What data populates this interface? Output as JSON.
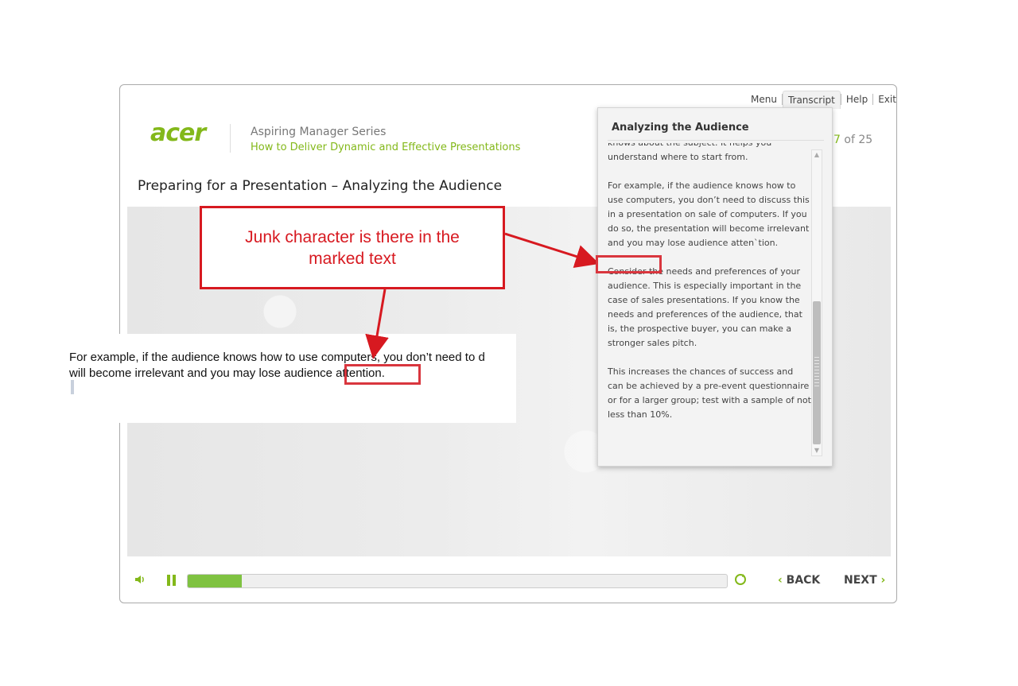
{
  "nav": {
    "menu": "Menu",
    "transcript": "Transcript",
    "help": "Help",
    "exit": "Exit"
  },
  "header": {
    "logo": "acer",
    "series": "Aspiring Manager Series",
    "course": "How to Deliver Dynamic and Effective Presentations"
  },
  "page_counter": {
    "current": "7",
    "of_total": " of 25"
  },
  "slide": {
    "title": "Preparing for a Presentation – Analyzing the Audience",
    "text_line1": "For example,  if the audience  knows  how to  use computers,  you  don’t need  to d",
    "text_line2": "will become  irrelevant and you may  lose audience  attention."
  },
  "annotation": {
    "callout": "Junk character is there in the marked text"
  },
  "transcript": {
    "title": "Analyzing the Audience",
    "paragraphs": [
      "knows about the subject. It helps you understand where to start from.",
      "For example, if the audience knows how to use computers, you don’t need to discuss this in a presentation on sale of computers. If you do so, the presentation will become irrelevant and you may lose audience atten`tion.",
      "Consider the needs and preferences of your audience. This is especially important in the case of sales presentations. If you know the needs and preferences of the audience, that is, the prospective buyer, you can make a stronger sales pitch.",
      "This increases the chances of success and can be achieved by a pre-event questionnaire or for a larger group; test with a sample of not less than 10%."
    ]
  },
  "player": {
    "progress": 0.1,
    "back": "BACK",
    "next": "NEXT"
  },
  "colors": {
    "brand": "#83b81a",
    "annotation": "#d71920"
  },
  "icons": [
    "volume-icon",
    "pause-icon",
    "replay-icon",
    "chevron-left-icon",
    "chevron-right-icon"
  ]
}
